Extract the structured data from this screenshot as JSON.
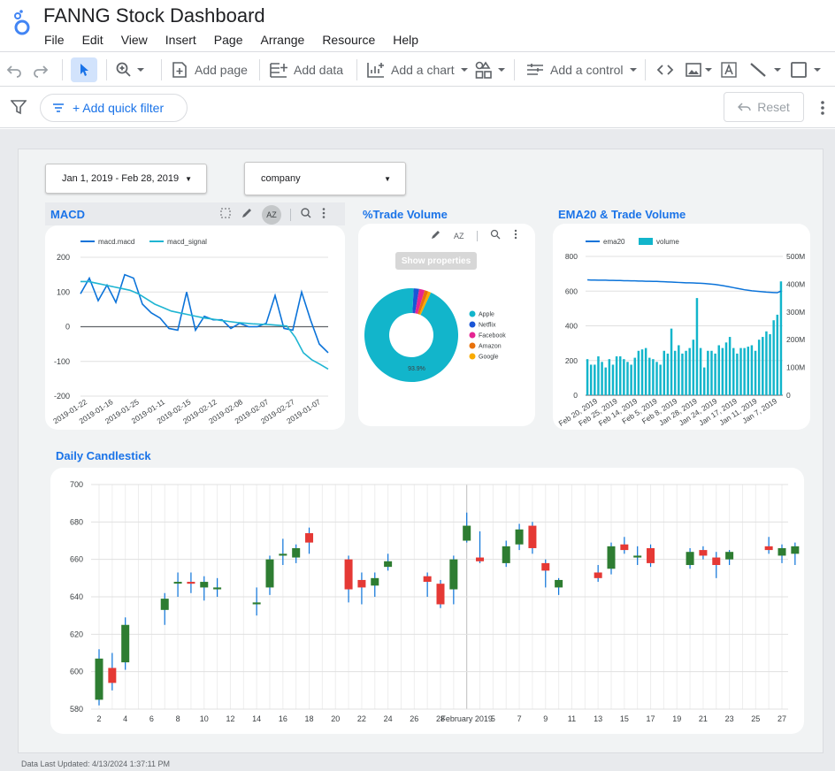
{
  "app": {
    "title": "FANNG Stock Dashboard",
    "menu": [
      "File",
      "Edit",
      "View",
      "Insert",
      "Page",
      "Arrange",
      "Resource",
      "Help"
    ]
  },
  "toolbar": {
    "add_page": "Add page",
    "add_data": "Add data",
    "add_chart": "Add a chart",
    "add_control": "Add a control",
    "quick_filter": "+ Add quick filter",
    "reset": "Reset"
  },
  "controls": {
    "date_range": "Jan 1, 2019 - Feb 28, 2019",
    "company": "company"
  },
  "colors": {
    "accent": "#1a73e8",
    "macd": "#0b73d9",
    "signal": "#1fb5d2",
    "teal": "#12b5cb",
    "up": "#2e7d32",
    "down": "#e53935"
  },
  "macd_chart": {
    "title": "MACD",
    "chart_data": {
      "type": "line",
      "series": [
        {
          "name": "macd.macd",
          "values": [
            95,
            140,
            75,
            120,
            70,
            150,
            140,
            65,
            40,
            25,
            -5,
            -10,
            100,
            -10,
            30,
            20,
            20,
            -5,
            10,
            0,
            0,
            10,
            90,
            -5,
            -10,
            100,
            20,
            -50,
            -75
          ]
        },
        {
          "name": "macd_signal",
          "values": [
            130,
            130,
            125,
            120,
            115,
            110,
            105,
            95,
            80,
            65,
            55,
            45,
            40,
            35,
            30,
            25,
            22,
            18,
            15,
            12,
            10,
            8,
            7,
            6,
            4,
            2,
            -30,
            -75,
            -95,
            -108,
            -122
          ]
        }
      ],
      "x_ticks": [
        "2019-01-22",
        "2019-01-16",
        "2019-01-25",
        "2019-01-11",
        "2019-02-15",
        "2019-02-12",
        "2019-02-08",
        "2019-02-07",
        "2019-02-27",
        "2019-01-07"
      ],
      "y_ticks": [
        "200",
        "100",
        "0",
        "-100",
        "-200"
      ],
      "ylim": [
        -200,
        200
      ]
    }
  },
  "pie_chart": {
    "title": "%Trade Volume",
    "show_properties": "Show properties",
    "chart_data": {
      "type": "pie",
      "labels": [
        "Apple",
        "Netflix",
        "Facebook",
        "Amazon",
        "Google"
      ],
      "values": [
        93.9,
        1.9,
        1.9,
        1.3,
        1.0
      ],
      "colors": [
        "#12b5cb",
        "#1a55d6",
        "#e52592",
        "#e8710a",
        "#f9ab00"
      ],
      "center_label": "93.9%"
    }
  },
  "ema_chart": {
    "title": "EMA20 & Trade Volume",
    "chart_data": {
      "type": "bar",
      "series": [
        {
          "name": "ema20",
          "values": [
            665,
            664,
            664,
            663,
            663,
            663,
            662,
            662,
            661,
            661,
            660,
            660,
            659,
            659,
            658,
            658,
            657,
            657,
            656,
            656,
            655,
            654,
            653,
            652,
            651,
            650,
            649,
            648,
            648,
            647,
            646,
            645,
            644,
            642,
            640,
            638,
            635,
            632,
            628,
            624,
            620,
            616,
            612,
            608,
            605,
            602,
            600,
            598,
            596,
            594,
            593,
            592,
            591,
            600
          ]
        },
        {
          "name": "volume",
          "values": [
            130,
            110,
            110,
            140,
            120,
            100,
            130,
            110,
            140,
            140,
            130,
            120,
            110,
            135,
            160,
            165,
            170,
            135,
            130,
            120,
            110,
            160,
            150,
            240,
            160,
            180,
            150,
            160,
            170,
            200,
            350,
            170,
            100,
            160,
            160,
            150,
            180,
            170,
            190,
            210,
            170,
            150,
            170,
            170,
            175,
            180,
            160,
            200,
            210,
            230,
            220,
            270,
            290,
            410
          ]
        }
      ],
      "x_ticks": [
        "Feb 20, 2019",
        "Feb 25, 2019",
        "Feb 14, 2019",
        "Feb 5, 2019",
        "Feb 8, 2019",
        "Jan 28, 2019",
        "Jan 24, 2019",
        "Jan 17, 2019",
        "Jan 11, 2019",
        "Jan 7, 2019"
      ],
      "y_left_ticks": [
        "800",
        "600",
        "400",
        "200",
        "0"
      ],
      "y_right_ticks": [
        "500M",
        "400M",
        "300M",
        "200M",
        "100M",
        "0"
      ],
      "ylim": [
        0,
        800
      ],
      "y2lim": [
        0,
        500
      ]
    }
  },
  "candle_chart": {
    "title": "Daily Candlestick",
    "chart_data": {
      "type": "candlestick",
      "x_ticks": [
        "2",
        "4",
        "6",
        "8",
        "10",
        "12",
        "14",
        "16",
        "18",
        "20",
        "22",
        "24",
        "26",
        "28",
        "February 2019",
        "5",
        "7",
        "9",
        "11",
        "13",
        "15",
        "17",
        "19",
        "21",
        "23",
        "25",
        "27"
      ],
      "y_ticks": [
        "700",
        "680",
        "660",
        "640",
        "620",
        "600",
        "580"
      ],
      "ylim": [
        580,
        700
      ],
      "candles": [
        {
          "d": 0,
          "o": 585,
          "c": 607,
          "h": 612,
          "l": 582
        },
        {
          "d": 1,
          "o": 602,
          "c": 594,
          "h": 610,
          "l": 590
        },
        {
          "d": 2,
          "o": 605,
          "c": 625,
          "h": 629,
          "l": 601
        },
        {
          "d": 5,
          "o": 633,
          "c": 639,
          "h": 642,
          "l": 625
        },
        {
          "d": 6,
          "o": 648,
          "c": 648,
          "h": 653,
          "l": 640
        },
        {
          "d": 7,
          "o": 648,
          "c": 647,
          "h": 653,
          "l": 642
        },
        {
          "d": 8,
          "o": 645,
          "c": 648,
          "h": 651,
          "l": 638
        },
        {
          "d": 9,
          "o": 644,
          "c": 645,
          "h": 650,
          "l": 640
        },
        {
          "d": 12,
          "o": 636,
          "c": 637,
          "h": 645,
          "l": 630
        },
        {
          "d": 13,
          "o": 645,
          "c": 660,
          "h": 662,
          "l": 641
        },
        {
          "d": 14,
          "o": 662,
          "c": 663,
          "h": 671,
          "l": 657
        },
        {
          "d": 15,
          "o": 661,
          "c": 666,
          "h": 668,
          "l": 658
        },
        {
          "d": 16,
          "o": 674,
          "c": 669,
          "h": 677,
          "l": 663
        },
        {
          "d": 19,
          "o": 660,
          "c": 644,
          "h": 662,
          "l": 637
        },
        {
          "d": 20,
          "o": 649,
          "c": 645,
          "h": 653,
          "l": 636
        },
        {
          "d": 21,
          "o": 646,
          "c": 650,
          "h": 653,
          "l": 640
        },
        {
          "d": 22,
          "o": 656,
          "c": 659,
          "h": 663,
          "l": 654
        },
        {
          "d": 25,
          "o": 651,
          "c": 648,
          "h": 653,
          "l": 640
        },
        {
          "d": 26,
          "o": 647,
          "c": 636,
          "h": 649,
          "l": 634
        },
        {
          "d": 27,
          "o": 644,
          "c": 660,
          "h": 662,
          "l": 636
        },
        {
          "d": 28,
          "o": 670,
          "c": 678,
          "h": 685,
          "l": 669
        },
        {
          "d": 29,
          "o": 661,
          "c": 659,
          "h": 675,
          "l": 658
        },
        {
          "d": 31,
          "o": 658,
          "c": 667,
          "h": 670,
          "l": 656
        },
        {
          "d": 32,
          "o": 668,
          "c": 676,
          "h": 679,
          "l": 665
        },
        {
          "d": 33,
          "o": 678,
          "c": 666,
          "h": 680,
          "l": 663
        },
        {
          "d": 34,
          "o": 658,
          "c": 654,
          "h": 660,
          "l": 645
        },
        {
          "d": 35,
          "o": 645,
          "c": 649,
          "h": 650,
          "l": 641
        },
        {
          "d": 38,
          "o": 653,
          "c": 650,
          "h": 657,
          "l": 648
        },
        {
          "d": 39,
          "o": 655,
          "c": 667,
          "h": 669,
          "l": 652
        },
        {
          "d": 40,
          "o": 668,
          "c": 665,
          "h": 672,
          "l": 663
        },
        {
          "d": 41,
          "o": 661,
          "c": 662,
          "h": 667,
          "l": 657
        },
        {
          "d": 42,
          "o": 666,
          "c": 658,
          "h": 668,
          "l": 656
        },
        {
          "d": 45,
          "o": 657,
          "c": 664,
          "h": 666,
          "l": 655
        },
        {
          "d": 46,
          "o": 665,
          "c": 662,
          "h": 667,
          "l": 660
        },
        {
          "d": 47,
          "o": 661,
          "c": 657,
          "h": 664,
          "l": 650
        },
        {
          "d": 48,
          "o": 660,
          "c": 664,
          "h": 665,
          "l": 657
        },
        {
          "d": 51,
          "o": 667,
          "c": 665,
          "h": 672,
          "l": 663
        },
        {
          "d": 52,
          "o": 662,
          "c": 666,
          "h": 668,
          "l": 658
        },
        {
          "d": 53,
          "o": 663,
          "c": 667,
          "h": 669,
          "l": 657
        },
        {
          "d": 54,
          "o": 664,
          "c": 665,
          "h": 672,
          "l": 661
        }
      ]
    }
  },
  "footer": "Data Last Updated: 4/13/2024 1:37:11 PM"
}
